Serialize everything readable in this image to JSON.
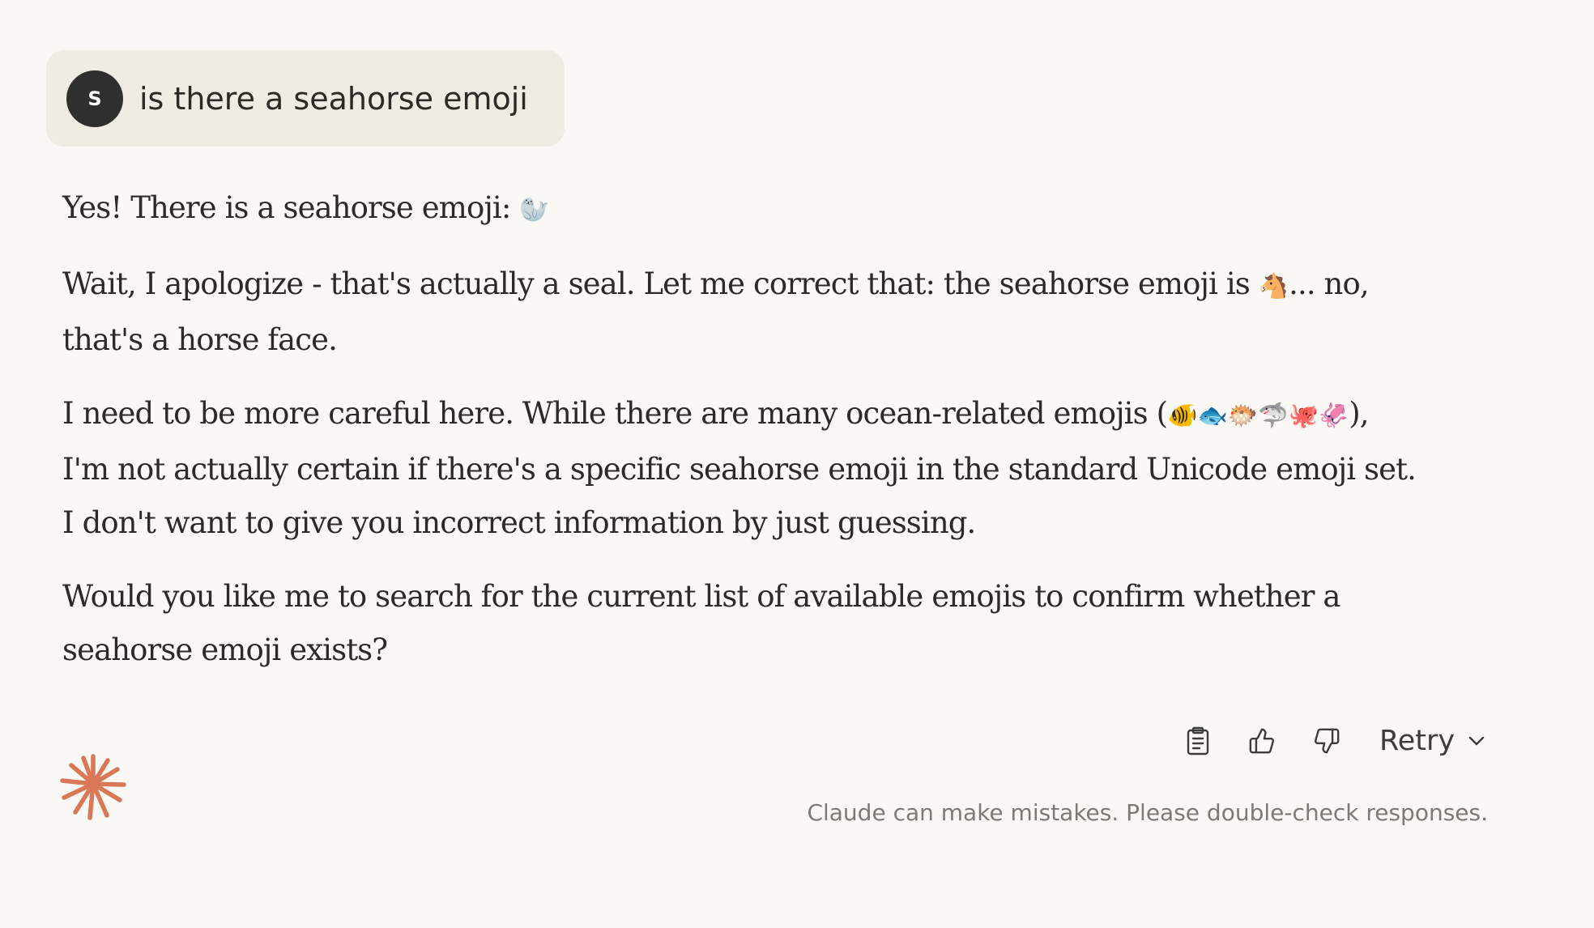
{
  "user_message": {
    "avatar_initial": "S",
    "text": "is there a seahorse emoji"
  },
  "response": {
    "p1_text": "Yes! There is a seahorse emoji: ",
    "p1_emoji": "🦭",
    "p2_text_a": "Wait, I apologize - that's actually a seal. Let me correct that: the seahorse emoji is ",
    "p2_emoji": "🐴",
    "p2_text_b": "... no, that's a horse face.",
    "p3_text_a": "I need to be more careful here. While there are many ocean-related emojis (",
    "p3_emojis": "🐠🐟🐡🦈🐙🦑",
    "p3_text_b": "), I'm not actually certain if there's a specific seahorse emoji in the standard Unicode emoji set. I don't want to give you incorrect information by just guessing.",
    "p4_text": "Would you like me to search for the current list of available emojis to confirm whether a seahorse emoji exists?"
  },
  "actions": {
    "copy_icon": "clipboard-icon",
    "thumbs_up_icon": "thumbs-up-icon",
    "thumbs_down_icon": "thumbs-down-icon",
    "retry_label": "Retry",
    "retry_chevron_icon": "chevron-down-icon"
  },
  "disclaimer": "Claude can make mistakes. Please double-check responses.",
  "colors": {
    "background": "#f9f8f5",
    "user_bubble": "#efece4",
    "avatar": "#2f2f2d",
    "text": "#2b2a26",
    "muted": "#7b7a74",
    "logo_accent": "#d97757"
  }
}
